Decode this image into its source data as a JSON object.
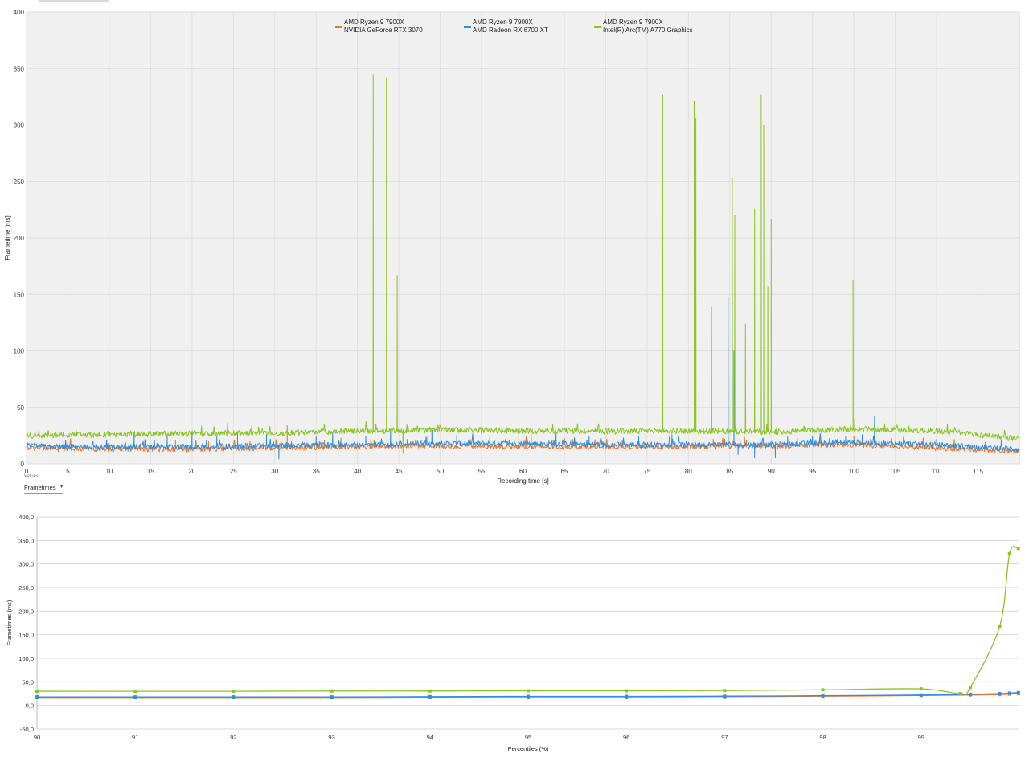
{
  "chart_data": [
    {
      "type": "line",
      "xlabel": "Recording time [s]",
      "ylabel": "Frametime [ms]",
      "xlim": [
        0,
        120
      ],
      "ylim": [
        0,
        400
      ],
      "xticks": [
        0,
        5,
        10,
        15,
        20,
        25,
        30,
        35,
        40,
        45,
        50,
        55,
        60,
        65,
        70,
        75,
        80,
        85,
        90,
        95,
        100,
        105,
        110,
        115
      ],
      "yticks": [
        0,
        50,
        100,
        150,
        200,
        250,
        300,
        350,
        400
      ],
      "grid": true,
      "legend_position": "top-center",
      "series": [
        {
          "name": "AMD Ryzen 9 7900X\nNVIDIA GeForce RTX 3070",
          "color": "#e8762b",
          "base": [
            [
              0,
              14
            ],
            [
              10,
              13
            ],
            [
              20,
              13
            ],
            [
              30,
              14
            ],
            [
              40,
              15
            ],
            [
              50,
              16
            ],
            [
              60,
              15
            ],
            [
              70,
              15
            ],
            [
              80,
              15
            ],
            [
              90,
              16
            ],
            [
              100,
              17
            ],
            [
              110,
              14
            ],
            [
              120,
              11
            ]
          ],
          "spikes": [
            [
              4.5,
              20
            ],
            [
              12,
              19
            ],
            [
              18,
              21
            ],
            [
              22,
              20
            ],
            [
              27,
              20
            ],
            [
              31.5,
              34
            ],
            [
              36,
              21
            ],
            [
              38,
              23
            ],
            [
              42,
              21
            ],
            [
              46,
              22
            ],
            [
              48.5,
              24
            ],
            [
              53,
              22
            ],
            [
              57,
              21
            ],
            [
              59.5,
              24
            ],
            [
              61,
              26
            ],
            [
              66,
              22
            ],
            [
              72,
              21
            ],
            [
              78,
              22
            ],
            [
              83,
              22
            ],
            [
              87,
              21
            ],
            [
              92,
              21
            ],
            [
              98,
              22
            ],
            [
              100,
              25
            ],
            [
              102,
              22
            ],
            [
              108,
              20
            ],
            [
              112,
              18
            ]
          ]
        },
        {
          "name": "AMD Ryzen 9 7900X\nAMD Radeon RX 6700 XT",
          "color": "#2f8fdc",
          "base": [
            [
              0,
              16
            ],
            [
              10,
              15
            ],
            [
              20,
              15
            ],
            [
              30,
              16
            ],
            [
              40,
              17
            ],
            [
              50,
              18
            ],
            [
              60,
              18
            ],
            [
              70,
              17
            ],
            [
              80,
              17
            ],
            [
              90,
              17
            ],
            [
              100,
              19
            ],
            [
              110,
              17
            ],
            [
              120,
              13
            ]
          ],
          "spikes": [
            [
              5,
              23
            ],
            [
              13,
              28
            ],
            [
              17,
              25
            ],
            [
              20,
              28
            ],
            [
              23,
              25
            ],
            [
              25.5,
              28
            ],
            [
              29,
              26
            ],
            [
              30.5,
              4
            ],
            [
              35,
              24
            ],
            [
              37,
              28
            ],
            [
              41,
              25
            ],
            [
              44,
              30
            ],
            [
              49,
              30
            ],
            [
              52,
              26
            ],
            [
              56,
              25
            ],
            [
              60,
              27
            ],
            [
              64,
              28
            ],
            [
              68,
              25
            ],
            [
              74,
              25
            ],
            [
              78,
              26
            ],
            [
              84.8,
              148
            ],
            [
              85.5,
              100
            ],
            [
              86,
              8
            ],
            [
              88,
              5
            ],
            [
              90.5,
              5
            ],
            [
              92,
              24
            ],
            [
              95,
              25
            ],
            [
              99,
              24
            ],
            [
              101,
              26
            ],
            [
              102.5,
              42
            ],
            [
              106,
              24
            ],
            [
              110,
              22
            ]
          ]
        },
        {
          "name": "AMD Ryzen 9 7900X\nIntel(R) Arc(TM) A770 Graphics",
          "color": "#8cc522",
          "base": [
            [
              0,
              25
            ],
            [
              10,
              26
            ],
            [
              20,
              27
            ],
            [
              30,
              27
            ],
            [
              40,
              29
            ],
            [
              50,
              30
            ],
            [
              60,
              29
            ],
            [
              70,
              29
            ],
            [
              80,
              29
            ],
            [
              90,
              28
            ],
            [
              100,
              31
            ],
            [
              105,
              30
            ],
            [
              110,
              29
            ],
            [
              115,
              26
            ],
            [
              120,
              22
            ]
          ],
          "spikes": [
            [
              41.9,
              345
            ],
            [
              43.5,
              342
            ],
            [
              44.8,
              167
            ],
            [
              45.5,
              9
            ],
            [
              76.9,
              327
            ],
            [
              80.7,
              321
            ],
            [
              80.9,
              306
            ],
            [
              82.8,
              139
            ],
            [
              85.3,
              254
            ],
            [
              85.6,
              220
            ],
            [
              86.9,
              124
            ],
            [
              88.0,
              226
            ],
            [
              88.8,
              327
            ],
            [
              89.1,
              300
            ],
            [
              89.6,
              157
            ],
            [
              90.0,
              217
            ],
            [
              99.9,
              163
            ],
            [
              100.1,
              40
            ]
          ]
        }
      ]
    },
    {
      "type": "line",
      "xlabel": "Percentiles (%)",
      "ylabel": "Frametimes (ms)",
      "xlim": [
        90,
        100
      ],
      "ylim": [
        -50,
        400
      ],
      "xticks": [
        90,
        91,
        92,
        93,
        94,
        95,
        96,
        97,
        98,
        99
      ],
      "yticks": [
        "-50,0",
        "0,0",
        "50,0",
        "100,0",
        "150,0",
        "200,0",
        "250,0",
        "300,0",
        "350,0",
        "400,0"
      ],
      "grid": true,
      "series": [
        {
          "name": "AMD Ryzen 9 7900X\nNVIDIA GeForce RTX 3070",
          "color": "#e8762b",
          "x": [
            90.0,
            91.0,
            92.0,
            93.0,
            94.0,
            95.0,
            96.0,
            97.0,
            98.0,
            99.0,
            99.5,
            99.8,
            99.9,
            99.99
          ],
          "y": [
            17,
            17,
            17,
            17,
            17.5,
            18,
            18,
            18.5,
            19.5,
            21,
            22,
            23,
            24,
            25
          ]
        },
        {
          "name": "AMD Ryzen 9 7900X\nAMD Radeon RX 6700 XT",
          "color": "#2f8fdc",
          "x": [
            90.0,
            91.0,
            92.0,
            93.0,
            94.0,
            95.0,
            96.0,
            97.0,
            98.0,
            99.0,
            99.5,
            99.8,
            99.9,
            99.99
          ],
          "y": [
            18,
            18,
            18,
            18,
            18.5,
            19,
            19,
            19.5,
            20.5,
            22,
            23.5,
            25,
            26,
            27
          ]
        },
        {
          "name": "AMD Ryzen 9 7900X\nIntel(R) Arc(TM) A770 Graphics",
          "color": "#8cc522",
          "x": [
            90.0,
            91.0,
            92.0,
            93.0,
            94.0,
            95.0,
            96.0,
            97.0,
            98.0,
            99.0,
            99.4,
            99.5,
            99.8,
            99.9,
            99.99
          ],
          "y": [
            30,
            30,
            30,
            30.5,
            30.5,
            31,
            31,
            31.5,
            33,
            35,
            25,
            38,
            168,
            322,
            333
          ]
        }
      ]
    }
  ],
  "controls": {
    "values_caption": "Values",
    "metric_selected": "Frametimes"
  }
}
